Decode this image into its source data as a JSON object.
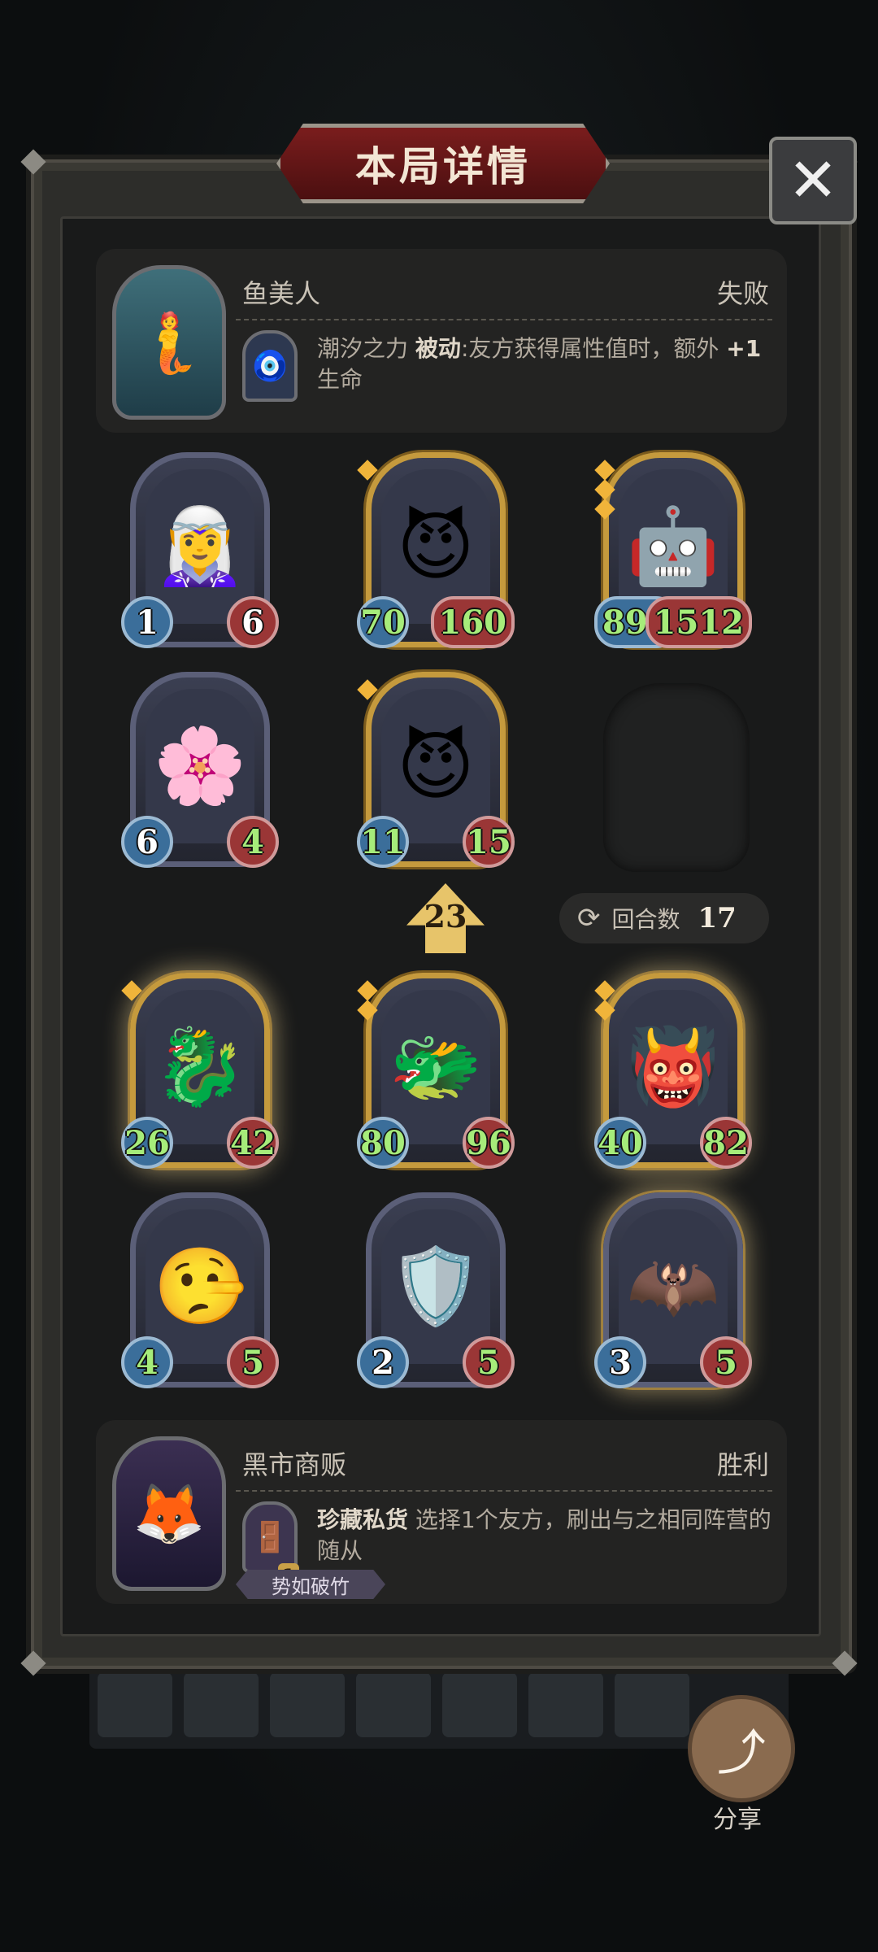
{
  "title": "本局详情",
  "close_label": "✕",
  "hero_top": {
    "portrait_icon": "🧜",
    "name": "鱼美人",
    "result": "失败",
    "power_icon": "🧿",
    "power_name": "潮汐之力",
    "power_type": "被动",
    "power_desc": ":友方获得属性值时，额外",
    "power_bonus": "+1",
    "power_bonus_text": "生命"
  },
  "board_top": [
    {
      "art": "🧝‍♀️",
      "attack": "1",
      "health": "6",
      "gold": false,
      "buffed_attack": false,
      "buffed_health": false,
      "stars": 0
    },
    {
      "art": "😈",
      "attack": "70",
      "health": "160",
      "gold": true,
      "buffed_attack": true,
      "buffed_health": true,
      "stars": 1
    },
    {
      "art": "🤖",
      "attack": "893",
      "health": "1512",
      "gold": true,
      "buffed_attack": true,
      "buffed_health": true,
      "stars": 3
    },
    {
      "art": "🌸",
      "attack": "6",
      "health": "4",
      "gold": false,
      "buffed_attack": false,
      "buffed_health": true,
      "stars": 0
    },
    {
      "art": "😈",
      "attack": "11",
      "health": "15",
      "gold": true,
      "buffed_attack": true,
      "buffed_health": true,
      "stars": 1
    }
  ],
  "level": "23",
  "rounds": {
    "icon": "⟳",
    "label": "回合数",
    "value": "17"
  },
  "board_bottom": [
    {
      "art": "🐉",
      "attack": "26",
      "health": "42",
      "gold": true,
      "buffed_attack": true,
      "buffed_health": true,
      "stars": 1
    },
    {
      "art": "🐲",
      "attack": "80",
      "health": "96",
      "gold": true,
      "buffed_attack": true,
      "buffed_health": true,
      "stars": 2
    },
    {
      "art": "👹",
      "attack": "40",
      "health": "82",
      "gold": true,
      "buffed_attack": true,
      "buffed_health": true,
      "stars": 2
    },
    {
      "art": "🤥",
      "attack": "4",
      "health": "5",
      "gold": false,
      "buffed_attack": true,
      "buffed_health": true,
      "stars": 0
    },
    {
      "art": "🛡️",
      "attack": "2",
      "health": "5",
      "gold": false,
      "buffed_attack": false,
      "buffed_health": true,
      "stars": 0
    },
    {
      "art": "🦇",
      "attack": "3",
      "health": "5",
      "gold": false,
      "buffed_attack": false,
      "buffed_health": true,
      "stars": 0
    }
  ],
  "hero_bottom": {
    "portrait_icon": "🦊",
    "name": "黑市商贩",
    "result": "胜利",
    "power_icon": "🚪",
    "power_cost": "1",
    "power_name": "珍藏私货",
    "power_desc": " 选择1个友方，刷出与之相同阵营的随从",
    "trait_tag": "势如破竹"
  },
  "share": {
    "icon": "⤴",
    "label": "分享"
  }
}
